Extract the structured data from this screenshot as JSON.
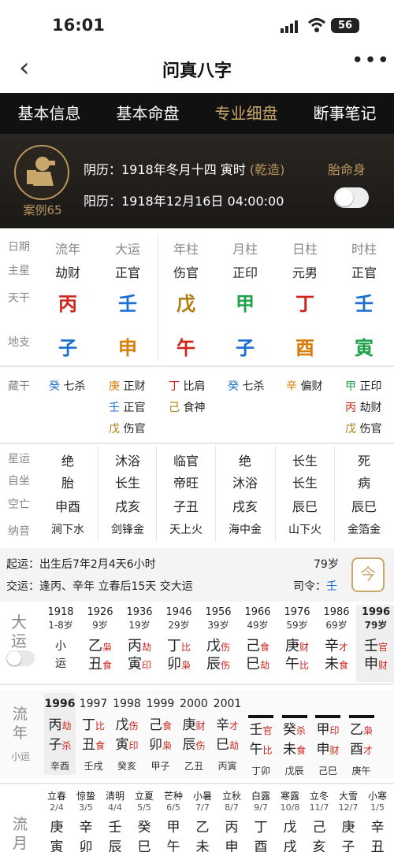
{
  "status": {
    "time": "16:01",
    "battery": "56"
  },
  "nav": {
    "title": "问真八字",
    "back": "‹",
    "more": "•••"
  },
  "tabs": [
    "基本信息",
    "基本命盘",
    "专业细盘",
    "断事笔记"
  ],
  "header": {
    "case_label": "案例65",
    "lunar": "阴历：1918年冬月十四  寅时",
    "lunar_tag": "(乾造)",
    "solar": "阳历：1918年12月16日 04:00:00",
    "taiming": "胎命身"
  },
  "grid": {
    "row_labels": [
      "日期",
      "主星",
      "天干",
      "地支"
    ],
    "columns": [
      {
        "head": "流年",
        "star": "劫财",
        "stem": "丙",
        "branch": "子"
      },
      {
        "head": "大运",
        "star": "正官",
        "stem": "壬",
        "branch": "申"
      },
      {
        "head": "年柱",
        "star": "伤官",
        "stem": "戊",
        "branch": "午"
      },
      {
        "head": "月柱",
        "star": "正印",
        "stem": "甲",
        "branch": "子"
      },
      {
        "head": "日柱",
        "star": "元男",
        "stem": "丁",
        "branch": "酉"
      },
      {
        "head": "时柱",
        "star": "正官",
        "stem": "壬",
        "branch": "寅"
      }
    ],
    "canggan_label": "藏干",
    "canggan": [
      [
        "癸 七杀"
      ],
      [
        "庚 正财",
        "壬 正官",
        "戊 伤官"
      ],
      [
        "丁 比肩",
        "己 食神"
      ],
      [
        "癸 七杀"
      ],
      [
        "辛 偏财"
      ],
      [
        "甲 正印",
        "丙 劫财",
        "戊 伤官"
      ]
    ],
    "lower_labels": [
      "星运",
      "自坐",
      "空亡",
      "纳音"
    ],
    "lower": [
      [
        "绝",
        "胎",
        "申酉",
        "涧下水"
      ],
      [
        "沐浴",
        "长生",
        "戌亥",
        "剑锋金"
      ],
      [
        "临官",
        "帝旺",
        "子丑",
        "天上火"
      ],
      [
        "绝",
        "沐浴",
        "戌亥",
        "海中金"
      ],
      [
        "长生",
        "长生",
        "辰巳",
        "山下火"
      ],
      [
        "死",
        "病",
        "辰巳",
        "金箔金"
      ]
    ]
  },
  "qiyun": {
    "line1": "起运：出生后7年2月4天6小时",
    "age": "79岁",
    "line2": "交运：逢丙、辛年 立春后15天 交大运",
    "siling": "司令：",
    "siling_val": "壬",
    "today_btn": "今"
  },
  "dayun": {
    "label": [
      "大",
      "运"
    ],
    "cols": [
      {
        "yr": "1918",
        "ag": "1-8岁",
        "g": "小",
        "z": "运",
        "s1": "",
        "s2": ""
      },
      {
        "yr": "1926",
        "ag": "9岁",
        "g": "乙",
        "z": "丑",
        "s1": "枭",
        "s2": "食"
      },
      {
        "yr": "1936",
        "ag": "19岁",
        "g": "丙",
        "z": "寅",
        "s1": "劫",
        "s2": "印"
      },
      {
        "yr": "1946",
        "ag": "29岁",
        "g": "丁",
        "z": "卯",
        "s1": "比",
        "s2": "枭"
      },
      {
        "yr": "1956",
        "ag": "39岁",
        "g": "戊",
        "z": "辰",
        "s1": "伤",
        "s2": "伤"
      },
      {
        "yr": "1966",
        "ag": "49岁",
        "g": "己",
        "z": "巳",
        "s1": "食",
        "s2": "劫"
      },
      {
        "yr": "1976",
        "ag": "59岁",
        "g": "庚",
        "z": "午",
        "s1": "财",
        "s2": "比"
      },
      {
        "yr": "1986",
        "ag": "69岁",
        "g": "辛",
        "z": "未",
        "s1": "才",
        "s2": "食"
      },
      {
        "yr": "1996",
        "ag": "79岁",
        "g": "壬",
        "z": "申",
        "s1": "官",
        "s2": "财"
      }
    ]
  },
  "liunian": {
    "label": [
      "流",
      "年"
    ],
    "xiaoyun": "小运",
    "cols": [
      {
        "yr": "1996",
        "g": "丙",
        "z": "子",
        "s1": "劫",
        "s2": "杀",
        "xy": "辛酉"
      },
      {
        "yr": "1997",
        "g": "丁",
        "z": "丑",
        "s1": "比",
        "s2": "食",
        "xy": "壬戌"
      },
      {
        "yr": "1998",
        "g": "戊",
        "z": "寅",
        "s1": "伤",
        "s2": "印",
        "xy": "癸亥"
      },
      {
        "yr": "1999",
        "g": "己",
        "z": "卯",
        "s1": "食",
        "s2": "枭",
        "xy": "甲子"
      },
      {
        "yr": "2000",
        "g": "庚",
        "z": "辰",
        "s1": "财",
        "s2": "伤",
        "xy": "乙丑"
      },
      {
        "yr": "2001",
        "g": "辛",
        "z": "巳",
        "s1": "才",
        "s2": "劫",
        "xy": "丙寅"
      },
      {
        "yr": "",
        "g": "壬",
        "z": "午",
        "s1": "官",
        "s2": "比",
        "xy": "丁卯"
      },
      {
        "yr": "",
        "g": "癸",
        "z": "未",
        "s1": "杀",
        "s2": "食",
        "xy": "戊辰"
      },
      {
        "yr": "",
        "g": "甲",
        "z": "申",
        "s1": "印",
        "s2": "财",
        "xy": "己巳"
      },
      {
        "yr": "",
        "g": "乙",
        "z": "酉",
        "s1": "枭",
        "s2": "才",
        "xy": "庚午"
      }
    ]
  },
  "liuyue": {
    "label": [
      "流",
      "月"
    ],
    "cols": [
      {
        "jq": "立春",
        "d": "2/4",
        "g": "庚",
        "z": "寅"
      },
      {
        "jq": "惊蛰",
        "d": "3/5",
        "g": "辛",
        "z": "卯"
      },
      {
        "jq": "清明",
        "d": "4/4",
        "g": "壬",
        "z": "辰"
      },
      {
        "jq": "立夏",
        "d": "5/5",
        "g": "癸",
        "z": "巳"
      },
      {
        "jq": "芒种",
        "d": "6/5",
        "g": "甲",
        "z": "午"
      },
      {
        "jq": "小暑",
        "d": "7/7",
        "g": "乙",
        "z": "未"
      },
      {
        "jq": "立秋",
        "d": "8/7",
        "g": "丙",
        "z": "申"
      },
      {
        "jq": "白露",
        "d": "9/7",
        "g": "丁",
        "z": "酉"
      },
      {
        "jq": "寒露",
        "d": "10/8",
        "g": "戊",
        "z": "戌"
      },
      {
        "jq": "立冬",
        "d": "11/7",
        "g": "己",
        "z": "亥"
      },
      {
        "jq": "大雪",
        "d": "12/7",
        "g": "庚",
        "z": "子"
      },
      {
        "jq": "小寒",
        "d": "1/5",
        "g": "辛",
        "z": "丑"
      }
    ]
  }
}
